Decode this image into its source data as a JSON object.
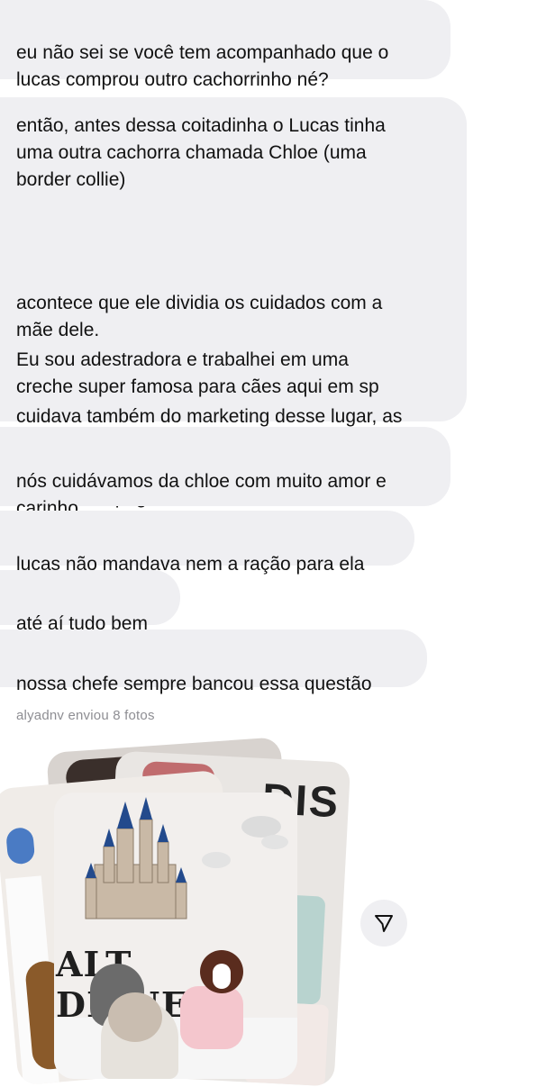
{
  "messages": [
    {
      "text": "eu não sei se você tem acompanhado que o\nlucas comprou outro cachorrinho né?"
    },
    {
      "text": "então, antes dessa coitadinha o Lucas tinha\numa outra cachorra chamada Chloe (uma\nborder collie)"
    },
    {
      "text": "acontece que ele dividia os cuidados com a\nmãe dele."
    },
    {
      "text": "Eu sou adestradora e trabalhei em uma\ncreche super famosa para cães aqui em sp"
    },
    {
      "text": "cuidava também do marketing desse lugar, as\ncachorras da mãe do lucas e a chloe\nfrequentavam essa creche e nunca\nprecisaram pagar 1 real"
    },
    {
      "text": "nós cuidávamos da chloe com muito amor e\ncarinho"
    },
    {
      "text": "lucas não mandava nem a ração para ela"
    },
    {
      "text": "até aí tudo bem"
    },
    {
      "text": "nossa chefe sempre bancou essa questão"
    }
  ],
  "attachment": {
    "caption": "alyadnv enviou 8 fotos",
    "photo_text": "ALT DISNEY",
    "photo_text_back": "DIS"
  },
  "actions": {
    "share_icon": "share-icon"
  },
  "colors": {
    "bubble_bg": "#efeff2",
    "caption": "#8e8e93",
    "background": "#ffffff"
  }
}
